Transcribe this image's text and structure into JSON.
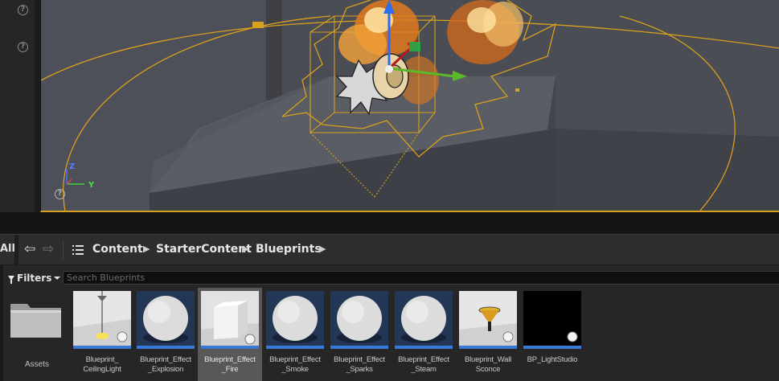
{
  "viewport": {
    "gizmo_z": "Z",
    "gizmo_y": "Y",
    "help_glyph": "?"
  },
  "left_panel": {
    "help_glyph_1": "?",
    "help_glyph_2": "?"
  },
  "content_browser": {
    "nav": {
      "all_label": "All",
      "back_glyph": "⇦",
      "forward_glyph": "⇨",
      "path": [
        "Content",
        "StarterContent",
        "Blueprints"
      ]
    },
    "filters_label": "Filters",
    "search_placeholder": "Search Blueprints",
    "folder": {
      "label": "Assets"
    },
    "assets": [
      {
        "line1": "Blueprint_",
        "line2": "CeilingLight",
        "thumb": "ceiling-light"
      },
      {
        "line1": "Blueprint_Effect",
        "line2": "_Explosion",
        "thumb": "sphere"
      },
      {
        "line1": "Blueprint_Effect",
        "line2": "_Fire",
        "thumb": "cube",
        "selected": true
      },
      {
        "line1": "Blueprint_Effect",
        "line2": "_Smoke",
        "thumb": "sphere"
      },
      {
        "line1": "Blueprint_Effect",
        "line2": "_Sparks",
        "thumb": "sphere"
      },
      {
        "line1": "Blueprint_Effect",
        "line2": "_Steam",
        "thumb": "sphere"
      },
      {
        "line1": "Blueprint_Wall",
        "line2": "Sconce",
        "thumb": "wall-sconce"
      },
      {
        "line1": "BP_LightStudio",
        "line2": "",
        "thumb": "black"
      }
    ],
    "colors": {
      "selection_accent": "#3a78d8",
      "viewport_highlight": "#d9a01e"
    }
  }
}
